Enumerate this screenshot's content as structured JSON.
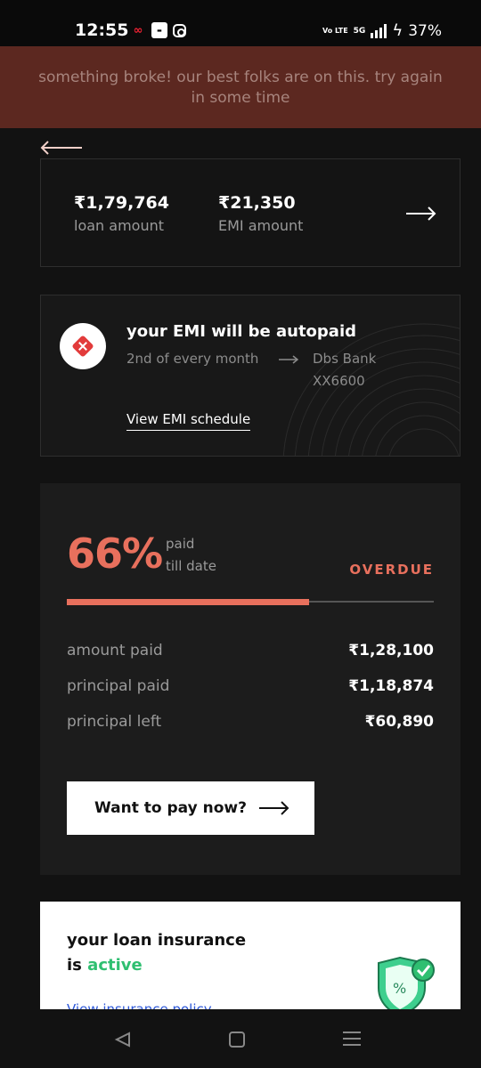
{
  "status_bar": {
    "time": "12:55",
    "volte": "Vo LTE",
    "network": "5G",
    "battery": "37%",
    "app_icons": [
      "oo-moneyview-icon",
      "notification-white-icon",
      "instagram-icon"
    ]
  },
  "error_banner": {
    "message": "something broke! our best folks are on this. try again in some time"
  },
  "loan_summary": {
    "loan_amount_value": "₹1,79,764",
    "loan_amount_label": "loan amount",
    "emi_amount_value": "₹21,350",
    "emi_amount_label": "EMI amount"
  },
  "autopay": {
    "title": "your EMI will be autopaid",
    "schedule": "2nd of every month",
    "bank_name": "Dbs Bank",
    "account": "XX6600",
    "link_label": "View EMI schedule"
  },
  "progress": {
    "percent_label": "66%",
    "percent_value": 0.66,
    "paid_label_line1": "paid",
    "paid_label_line2": "till date",
    "status": "OVERDUE",
    "stats": [
      {
        "label": "amount paid",
        "value": "₹1,28,100"
      },
      {
        "label": "principal paid",
        "value": "₹1,18,874"
      },
      {
        "label": "principal left",
        "value": "₹60,890"
      }
    ],
    "pay_button_label": "Want to pay now?"
  },
  "insurance": {
    "title_line1": "your loan insurance",
    "title_line2_prefix": "is",
    "title_line2_status": "active",
    "link_label": "View insurance policy"
  },
  "colors": {
    "accent": "#e8705d",
    "banner_bg": "#5c2820",
    "active_green": "#2fbf71",
    "background": "#121212"
  }
}
